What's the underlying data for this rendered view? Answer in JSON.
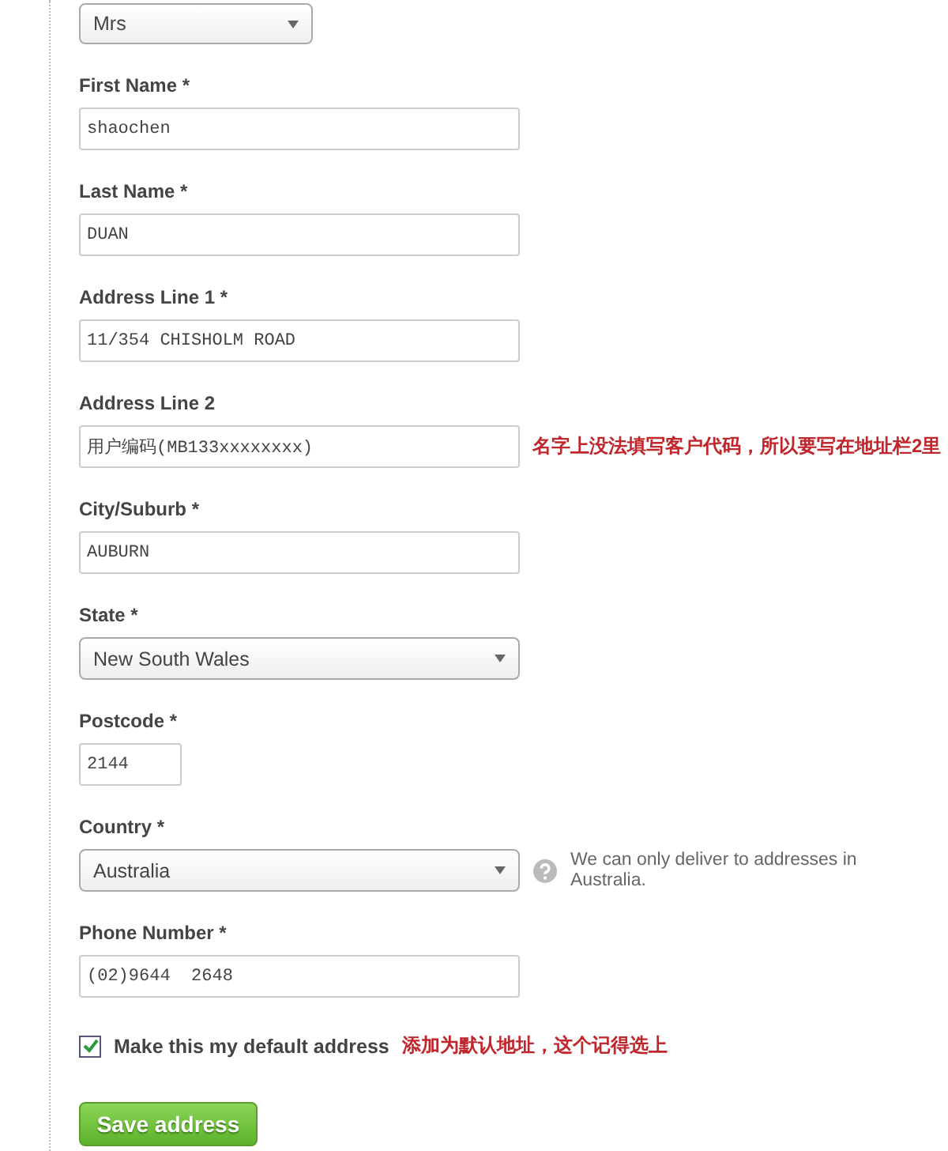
{
  "fields": [
    {
      "kind": "title-select",
      "value": "Mrs"
    },
    {
      "kind": "text",
      "label": "First Name *",
      "value": "shaochen"
    },
    {
      "kind": "text",
      "label": "Last Name *",
      "value": "DUAN"
    },
    {
      "kind": "text",
      "label": "Address Line 1 *",
      "value": "11/354 CHISHOLM ROAD"
    },
    {
      "kind": "text",
      "label": "Address Line 2",
      "value": "用户编码(MB133xxxxxxxx)",
      "note": "名字上没法填写客户代码，所以要写在地址栏2里"
    },
    {
      "kind": "text",
      "label": "City/Suburb *",
      "value": "AUBURN"
    },
    {
      "kind": "select",
      "label": "State *",
      "value": "New South Wales"
    },
    {
      "kind": "short-text",
      "label": "Postcode *",
      "value": "2144"
    },
    {
      "kind": "select",
      "label": "Country *",
      "value": "Australia",
      "help": "We can only deliver to addresses in Australia."
    },
    {
      "kind": "text",
      "label": "Phone Number *",
      "value": "(02)9644  2648"
    }
  ],
  "default_address": {
    "label": "Make this my default address",
    "checked": true,
    "note": "添加为默认地址，这个记得选上"
  },
  "save_button": "Save address"
}
